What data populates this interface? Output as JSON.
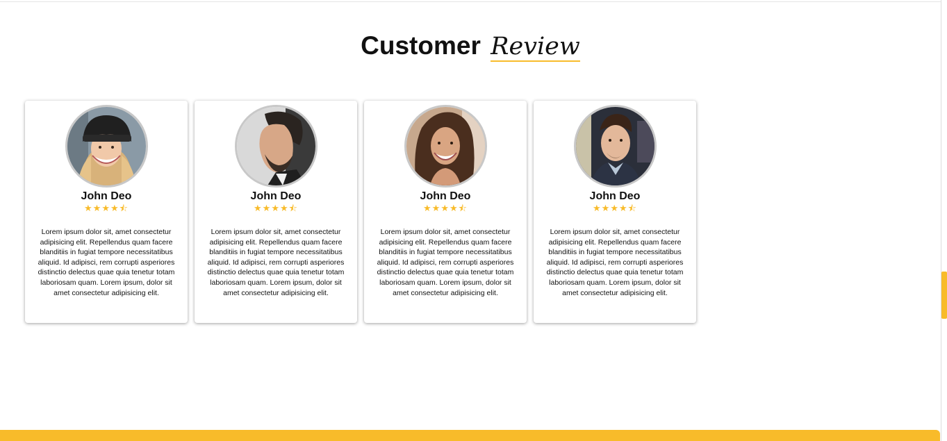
{
  "section": {
    "title_main": "Customer",
    "title_accent": "Review"
  },
  "colors": {
    "accent": "#f8bb2a",
    "text": "#111111"
  },
  "reviews": [
    {
      "name": "John Deo",
      "rating": 4.5,
      "stars": "★★★★⯪",
      "avatar": "woman-beanie-photo",
      "text": "Lorem ipsum dolor sit, amet consectetur adipisicing elit. Repellendus quam facere blanditiis in fugiat tempore necessitatibus aliquid. Id adipisci, rem corrupti asperiores distinctio delectus quae quia tenetur totam laboriosam quam. Lorem ipsum, dolor sit amet consectetur adipisicing elit."
    },
    {
      "name": "John Deo",
      "rating": 4.5,
      "stars": "★★★★⯪",
      "avatar": "man-beard-profile-photo",
      "text": "Lorem ipsum dolor sit, amet consectetur adipisicing elit. Repellendus quam facere blanditiis in fugiat tempore necessitatibus aliquid. Id adipisci, rem corrupti asperiores distinctio delectus quae quia tenetur totam laboriosam quam. Lorem ipsum, dolor sit amet consectetur adipisicing elit."
    },
    {
      "name": "John Deo",
      "rating": 4.5,
      "stars": "★★★★⯪",
      "avatar": "woman-curly-hair-photo",
      "text": "Lorem ipsum dolor sit, amet consectetur adipisicing elit. Repellendus quam facere blanditiis in fugiat tempore necessitatibus aliquid. Id adipisci, rem corrupti asperiores distinctio delectus quae quia tenetur totam laboriosam quam. Lorem ipsum, dolor sit amet consectetur adipisicing elit."
    },
    {
      "name": "John Deo",
      "rating": 4.5,
      "stars": "★★★★⯪",
      "avatar": "man-suit-photo",
      "text": "Lorem ipsum dolor sit, amet consectetur adipisicing elit. Repellendus quam facere blanditiis in fugiat tempore necessitatibus aliquid. Id adipisci, rem corrupti asperiores distinctio delectus quae quia tenetur totam laboriosam quam. Lorem ipsum, dolor sit amet consectetur adipisicing elit."
    }
  ]
}
